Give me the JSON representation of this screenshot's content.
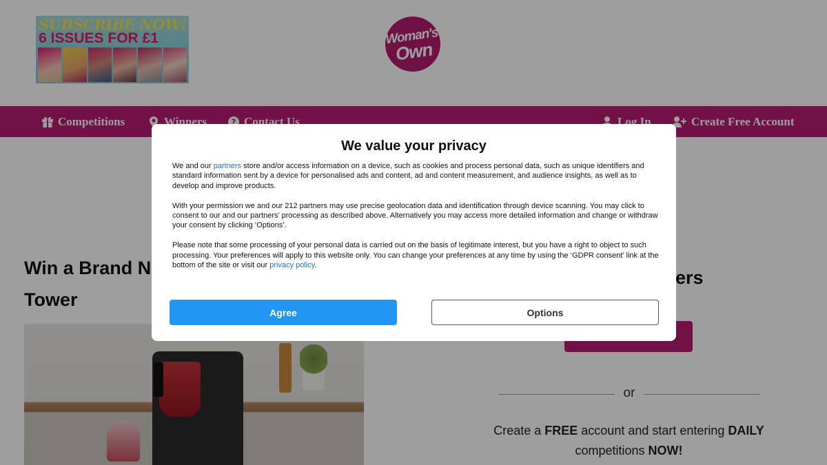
{
  "header": {
    "promo": {
      "line1": "SUBSCRIBE NOW!",
      "line2": "6 ISSUES FOR £1"
    },
    "logo": {
      "line1": "Woman's",
      "line2": "Own"
    }
  },
  "nav": {
    "left": [
      {
        "label": "Competitions",
        "icon": "gift-icon"
      },
      {
        "label": "Winners",
        "icon": "map-pin-icon"
      },
      {
        "label": "Contact Us",
        "icon": "question-icon"
      }
    ],
    "right": [
      {
        "label": "Log In",
        "icon": "user-icon"
      },
      {
        "label": "Create Free Account",
        "icon": "user-plus-icon"
      }
    ]
  },
  "article": {
    "title_line1": "Win a Brand Ne",
    "title_line2": "Tower"
  },
  "sidebar": {
    "heading_fragment": "ers",
    "or_text": "or",
    "cta": {
      "t1": "Create a ",
      "b1": "FREE",
      "t2": " account and start entering ",
      "b2": "DAILY",
      "t3": " competitions ",
      "b3": "NOW!"
    }
  },
  "privacy": {
    "title": "We value your privacy",
    "p1_before": "We and our ",
    "p1_link": "partners",
    "p1_after": " store and/or access information on a device, such as cookies and process personal data, such as unique identifiers and standard information sent by a device for personalised ads and content, ad and content measurement, and audience insights, as well as to develop and improve products.",
    "p2": "With your permission we and our 212 partners may use precise geolocation data and identification through device scanning. You may click to consent to our and our partners’ processing as described above. Alternatively you may access more detailed information and change or withdraw your consent by clicking ‘Options’.",
    "p3_before": "Please note that some processing of your personal data is carried out on the basis of legitimate interest, but you have a right to object to such processing. Your preferences will apply to this website only. You can change your preferences at any time by using the ‘GDPR consent’ link at the bottom of the site or visit our ",
    "p3_link": "privacy policy",
    "p3_after": ".",
    "agree_label": "Agree",
    "options_label": "Options"
  },
  "colors": {
    "brand_magenta": "#b81c74",
    "agree_blue": "#2196f3",
    "link_blue": "#1f6fc6"
  }
}
